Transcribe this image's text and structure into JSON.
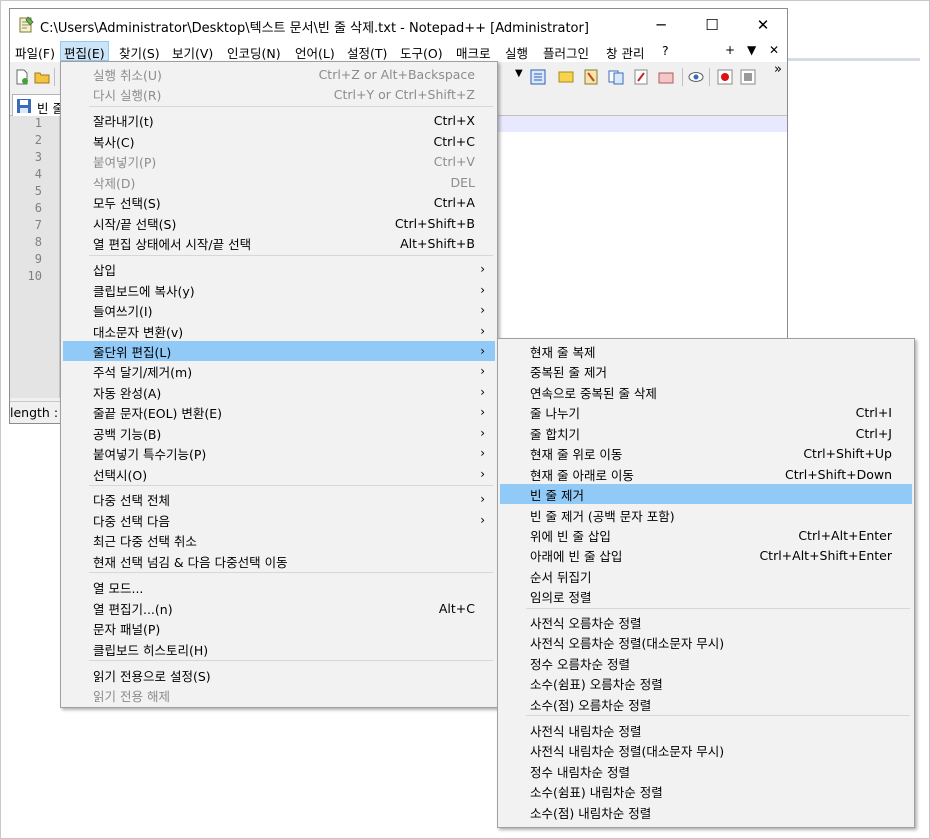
{
  "window": {
    "title": "C:\\Users\\Administrator\\Desktop\\텍스트 문서\\빈 줄 삭제.txt - Notepad++ [Administrator]",
    "minimize": "─",
    "maximize": "☐",
    "close": "✕"
  },
  "menubar": {
    "items": [
      "파일(F)",
      "편집(E)",
      "찾기(S)",
      "보기(V)",
      "인코딩(N)",
      "언어(L)",
      "설정(T)",
      "도구(O)",
      "매크로",
      "실행",
      "플러그인",
      "창 관리",
      "?"
    ],
    "right": [
      "+",
      "▼",
      "✕"
    ]
  },
  "toolbar": {
    "overflow": "»"
  },
  "tab": {
    "label": "빈 줄"
  },
  "editor": {
    "line_numbers": [
      "1",
      "2",
      "3",
      "4",
      "5",
      "6",
      "7",
      "8",
      "9",
      "10"
    ]
  },
  "status": {
    "length_label": "length : "
  },
  "edit_menu": {
    "items": [
      {
        "label": "실행 취소(U)",
        "shortcut": "Ctrl+Z or Alt+Backspace",
        "disabled": true
      },
      {
        "label": "다시 실행(R)",
        "shortcut": "Ctrl+Y or Ctrl+Shift+Z",
        "disabled": true
      },
      {
        "label": "잘라내기(t)",
        "shortcut": "Ctrl+X"
      },
      {
        "label": "복사(C)",
        "shortcut": "Ctrl+C"
      },
      {
        "label": "붙여넣기(P)",
        "shortcut": "Ctrl+V",
        "disabled": true
      },
      {
        "label": "삭제(D)",
        "shortcut": "DEL",
        "disabled": true
      },
      {
        "label": "모두 선택(S)",
        "shortcut": "Ctrl+A"
      },
      {
        "label": "시작/끝 선택(S)",
        "shortcut": "Ctrl+Shift+B"
      },
      {
        "label": "열 편집 상태에서 시작/끝 선택",
        "shortcut": "Alt+Shift+B"
      },
      {
        "label": "삽입",
        "submenu": true
      },
      {
        "label": "클립보드에 복사(y)",
        "submenu": true
      },
      {
        "label": "들여쓰기(I)",
        "submenu": true
      },
      {
        "label": "대소문자 변환(v)",
        "submenu": true
      },
      {
        "label": "줄단위 편집(L)",
        "submenu": true,
        "highlighted": true
      },
      {
        "label": "주석 달기/제거(m)",
        "submenu": true
      },
      {
        "label": "자동 완성(A)",
        "submenu": true
      },
      {
        "label": "줄끝 문자(EOL) 변환(E)",
        "submenu": true
      },
      {
        "label": "공백 기능(B)",
        "submenu": true
      },
      {
        "label": "붙여넣기 특수기능(P)",
        "submenu": true
      },
      {
        "label": "선택시(O)",
        "submenu": true
      },
      {
        "label": "다중 선택 전체",
        "submenu": true
      },
      {
        "label": "다중 선택 다음",
        "submenu": true
      },
      {
        "label": "최근 다중 선택 취소"
      },
      {
        "label": "현재 선택 넘김 & 다음 다중선택 이동"
      },
      {
        "label": "열 모드..."
      },
      {
        "label": "열 편집기...(n)",
        "shortcut": "Alt+C"
      },
      {
        "label": "문자 패널(P)"
      },
      {
        "label": "클립보드 히스토리(H)"
      },
      {
        "label": "읽기 전용으로 설정(S)"
      },
      {
        "label": "읽기 전용 해제",
        "disabled": true
      }
    ]
  },
  "line_menu": {
    "items": [
      {
        "label": "현재 줄 복제"
      },
      {
        "label": "중복된 줄 제거"
      },
      {
        "label": "연속으로 중복된 줄 삭제"
      },
      {
        "label": "줄 나누기",
        "shortcut": "Ctrl+I"
      },
      {
        "label": "줄 합치기",
        "shortcut": "Ctrl+J"
      },
      {
        "label": "현재 줄 위로 이동",
        "shortcut": "Ctrl+Shift+Up"
      },
      {
        "label": "현재 줄 아래로 이동",
        "shortcut": "Ctrl+Shift+Down"
      },
      {
        "label": "빈 줄 제거",
        "highlighted": true
      },
      {
        "label": "빈 줄 제거 (공백 문자 포함)"
      },
      {
        "label": "위에 빈 줄 삽입",
        "shortcut": "Ctrl+Alt+Enter"
      },
      {
        "label": "아래에 빈 줄 삽입",
        "shortcut": "Ctrl+Alt+Shift+Enter"
      },
      {
        "label": "순서 뒤집기"
      },
      {
        "label": "임의로 정렬"
      },
      {
        "label": "사전식 오름차순 정렬"
      },
      {
        "label": "사전식 오름차순 정렬(대소문자 무시)"
      },
      {
        "label": "정수 오름차순 정렬"
      },
      {
        "label": "소수(쉼표) 오름차순 정렬"
      },
      {
        "label": "소수(점) 오름차순 정렬"
      },
      {
        "label": "사전식 내림차순 정렬"
      },
      {
        "label": "사전식 내림차순 정렬(대소문자 무시)"
      },
      {
        "label": "정수 내림차순 정렬"
      },
      {
        "label": "소수(쉼표) 내림차순 정렬"
      },
      {
        "label": "소수(점) 내림차순 정렬"
      }
    ]
  }
}
